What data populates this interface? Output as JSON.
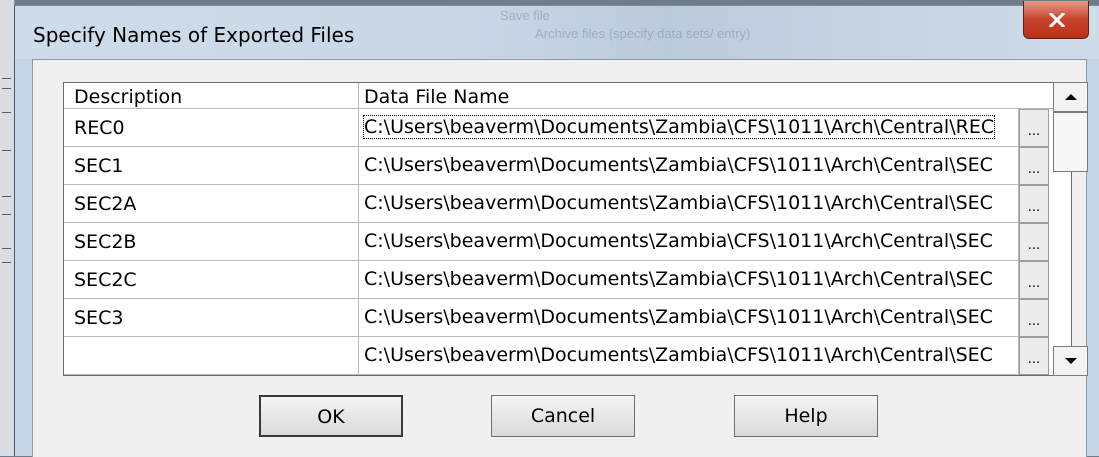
{
  "dialog": {
    "title": "Specify Names of Exported Files",
    "close_glyph": "✕"
  },
  "background_hint": {
    "line1": "Save file",
    "line2": "Archive files (specify data sets/ entry)"
  },
  "table": {
    "columns": [
      "Description",
      "Data File Name"
    ],
    "browse_label": "...",
    "rows": [
      {
        "description": "REC0",
        "file": "C:\\Users\\beaverm\\Documents\\Zambia\\CFS\\1011\\Arch\\Central\\REC"
      },
      {
        "description": "SEC1",
        "file": "C:\\Users\\beaverm\\Documents\\Zambia\\CFS\\1011\\Arch\\Central\\SEC"
      },
      {
        "description": "SEC2A",
        "file": "C:\\Users\\beaverm\\Documents\\Zambia\\CFS\\1011\\Arch\\Central\\SEC"
      },
      {
        "description": "SEC2B",
        "file": "C:\\Users\\beaverm\\Documents\\Zambia\\CFS\\1011\\Arch\\Central\\SEC"
      },
      {
        "description": "SEC2C",
        "file": "C:\\Users\\beaverm\\Documents\\Zambia\\CFS\\1011\\Arch\\Central\\SEC"
      },
      {
        "description": "SEC3",
        "file": "C:\\Users\\beaverm\\Documents\\Zambia\\CFS\\1011\\Arch\\Central\\SEC"
      },
      {
        "description": "",
        "file": "C:\\Users\\beaverm\\Documents\\Zambia\\CFS\\1011\\Arch\\Central\\SEC"
      }
    ]
  },
  "buttons": {
    "ok": "OK",
    "cancel": "Cancel",
    "help": "Help"
  },
  "colors": {
    "close_button": "#c9442c",
    "title_bar": "#c9d7e7",
    "dialog_bg": "#f0f0f0"
  }
}
